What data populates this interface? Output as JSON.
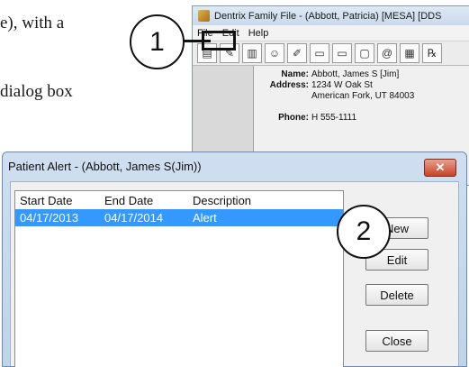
{
  "document": {
    "line1": "e), with a",
    "line2": "dialog box"
  },
  "callouts": [
    "1",
    "2"
  ],
  "dentrix_window": {
    "title": "Dentrix Family File - (Abbott, Patricia) [MESA] [DDS",
    "menu": [
      "File",
      "Edit",
      "Help"
    ],
    "patient": {
      "name_label": "Name:",
      "name_value": "Abbott, James S [Jim]",
      "address_label": "Address:",
      "address_line1": "1234 W Oak St",
      "address_line2": "American Fork, UT  84003",
      "phone_label": "Phone:",
      "phone_value": "H 555-1111"
    }
  },
  "dialog": {
    "title": "Patient Alert - (Abbott, James S(Jim))",
    "close_label": "✕",
    "columns": [
      "Start Date",
      "End Date",
      "Description"
    ],
    "rows": [
      {
        "start": "04/17/2013",
        "end": "04/17/2014",
        "description": "Alert"
      }
    ],
    "buttons": {
      "new": "New",
      "edit": "Edit",
      "delete": "Delete",
      "close": "Close"
    }
  },
  "colors": {
    "selection": "#3399ff",
    "close_button": "#c6432a",
    "callout_border": "#111111"
  }
}
